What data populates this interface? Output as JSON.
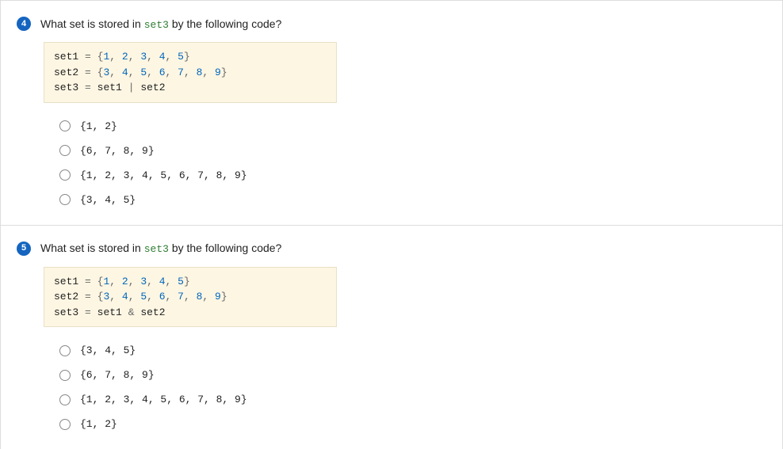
{
  "questions": [
    {
      "number": "4",
      "prompt_before": "What set is stored in ",
      "prompt_code": "set3",
      "prompt_after": " by the following code?",
      "code": {
        "id1": "set1",
        "op1": "=",
        "lit1_open": "{",
        "v1": "1",
        "v2": "2",
        "v3": "3",
        "v4": "4",
        "v5": "5",
        "lit1_close": "}",
        "id2": "set2",
        "op2": "=",
        "lit2_open": "{",
        "w1": "3",
        "w2": "4",
        "w3": "5",
        "w4": "6",
        "w5": "7",
        "w6": "8",
        "w7": "9",
        "lit2_close": "}",
        "id3": "set3",
        "op3": "=",
        "rhs_a": "set1",
        "rhs_op": "|",
        "rhs_b": "set2",
        "comma": ", "
      },
      "options": [
        "{1, 2}",
        "{6, 7, 8, 9}",
        "{1, 2, 3, 4, 5, 6, 7, 8, 9}",
        "{3, 4, 5}"
      ]
    },
    {
      "number": "5",
      "prompt_before": "What set is stored in ",
      "prompt_code": "set3",
      "prompt_after": " by the following code?",
      "code": {
        "id1": "set1",
        "op1": "=",
        "lit1_open": "{",
        "v1": "1",
        "v2": "2",
        "v3": "3",
        "v4": "4",
        "v5": "5",
        "lit1_close": "}",
        "id2": "set2",
        "op2": "=",
        "lit2_open": "{",
        "w1": "3",
        "w2": "4",
        "w3": "5",
        "w4": "6",
        "w5": "7",
        "w6": "8",
        "w7": "9",
        "lit2_close": "}",
        "id3": "set3",
        "op3": "=",
        "rhs_a": "set1",
        "rhs_op": "&",
        "rhs_b": "set2",
        "comma": ", "
      },
      "options": [
        "{3, 4, 5}",
        "{6, 7, 8, 9}",
        "{1, 2, 3, 4, 5, 6, 7, 8, 9}",
        "{1, 2}"
      ]
    }
  ]
}
